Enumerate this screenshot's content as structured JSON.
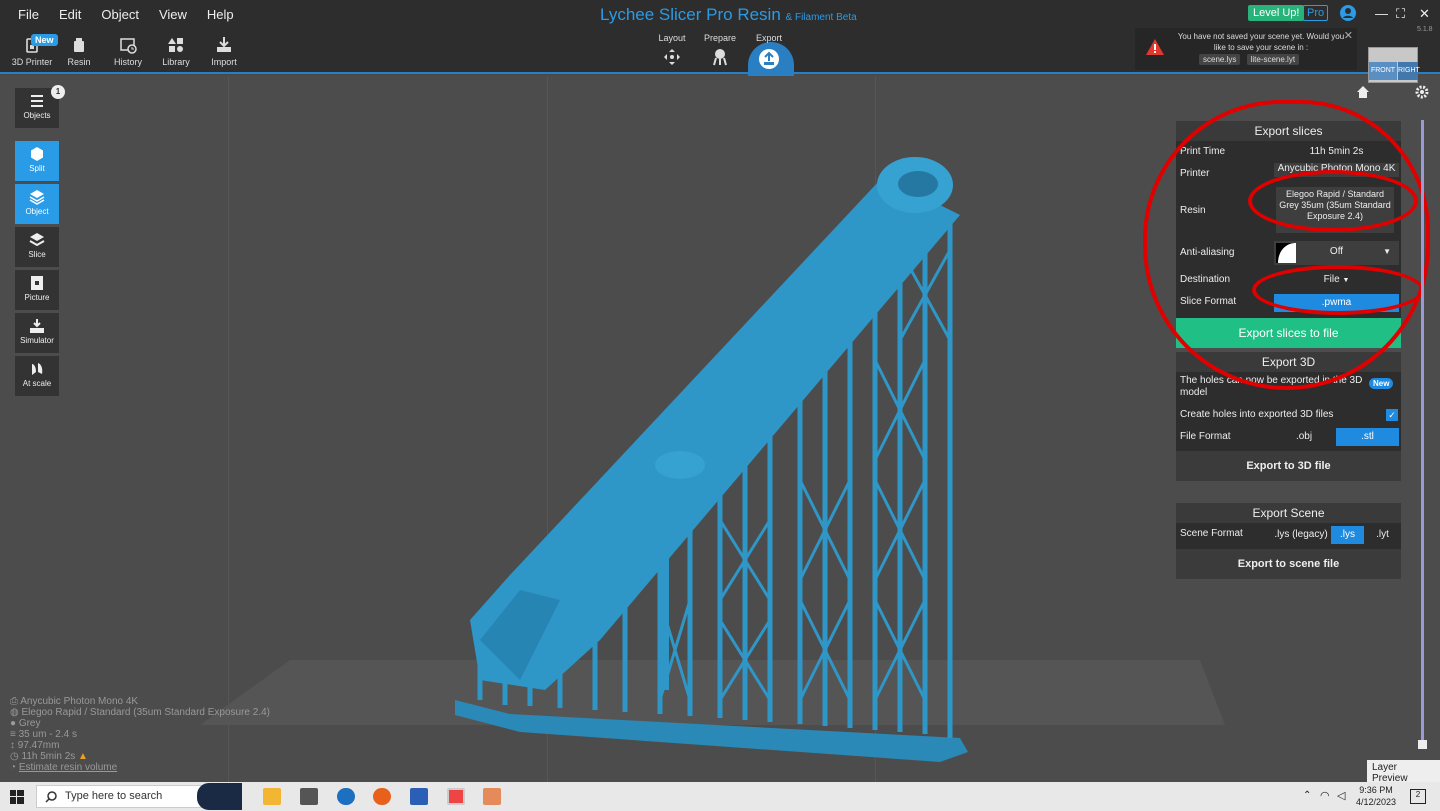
{
  "app": {
    "title": "Lychee Slicer Pro Resin",
    "title_suffix": "& Filament Beta",
    "version": "5.1.8"
  },
  "menu": [
    "File",
    "Edit",
    "Object",
    "View",
    "Help"
  ],
  "toolbar": {
    "new_badge": "New",
    "items": [
      {
        "label": "3D Printer",
        "icon": "printer-icon"
      },
      {
        "label": "Resin",
        "icon": "resin-bottle-icon"
      },
      {
        "label": "History",
        "icon": "history-icon"
      },
      {
        "label": "Library",
        "icon": "library-icon"
      },
      {
        "label": "Import",
        "icon": "import-icon"
      }
    ]
  },
  "steps": [
    {
      "label": "Layout",
      "icon": "layout-move-icon"
    },
    {
      "label": "Prepare",
      "icon": "prepare-supports-icon"
    },
    {
      "label": "Export",
      "icon": "export-upload-icon",
      "active": true
    }
  ],
  "topright": {
    "levelup": "Level Up!",
    "pro": "Pro"
  },
  "save_warning": {
    "message": "You have not saved your scene yet. Would you like to save your scene in :",
    "option1": "scene.lys",
    "option2": "lite-scene.lyt"
  },
  "viewcube": {
    "front": "FRONT",
    "right": "RIGHT"
  },
  "left_tools": {
    "objects_count": "1",
    "items": [
      {
        "label": "Objects",
        "icon": "objects-list-icon"
      },
      {
        "label": "Split",
        "icon": "split-cube-icon"
      },
      {
        "label": "Object",
        "icon": "object-layers-icon"
      },
      {
        "label": "Slice",
        "icon": "slice-icon"
      },
      {
        "label": "Picture",
        "icon": "picture-icon"
      },
      {
        "label": "Simulator",
        "icon": "simulator-icon"
      },
      {
        "label": "At scale",
        "icon": "at-scale-icon"
      }
    ]
  },
  "export_slices": {
    "header": "Export slices",
    "print_time_label": "Print Time",
    "print_time": "11h 5min 2s",
    "printer_label": "Printer",
    "printer": "Anycubic Photon Mono 4K",
    "resin_label": "Resin",
    "resin": "Elegoo Rapid / Standard Grey 35um  (35um Standard Exposure 2.4)",
    "aa_label": "Anti-aliasing",
    "aa_value": "Off",
    "destination_label": "Destination",
    "destination": "File",
    "format_label": "Slice Format",
    "format": ".pwma",
    "export_button": "Export slices to file"
  },
  "export_3d": {
    "header": "Export 3D",
    "note": "The holes can now be exported in the 3D model",
    "new_badge": "New",
    "holes_label": "Create holes into exported 3D files",
    "holes_checked": true,
    "format_label": "File Format",
    "formats": [
      ".obj",
      ".stl"
    ],
    "selected_format": ".stl",
    "export_button": "Export to 3D file"
  },
  "export_scene": {
    "header": "Export Scene",
    "format_label": "Scene Format",
    "formats": [
      ".lys (legacy)",
      ".lys",
      ".lyt"
    ],
    "selected_format": ".lys",
    "export_button": "Export to scene file"
  },
  "info": {
    "printer": "Anycubic Photon Mono 4K",
    "resin": "Elegoo Rapid / Standard (35um Standard Exposure 2.4)",
    "color": "Grey",
    "layer": "35 um - 2.4 s",
    "height": "97.47mm",
    "time": "11h 5min 2s",
    "estimate_link": "Estimate resin volume"
  },
  "layer_preview": "Layer Preview",
  "taskbar": {
    "search_placeholder": "Type here to search",
    "time": "9:36 PM",
    "date": "4/12/2023",
    "notifications": "2"
  },
  "colors": {
    "accent": "#2a9be6",
    "model": "#2f97c8",
    "green": "#1fbf86",
    "annotation": "#e00000"
  }
}
